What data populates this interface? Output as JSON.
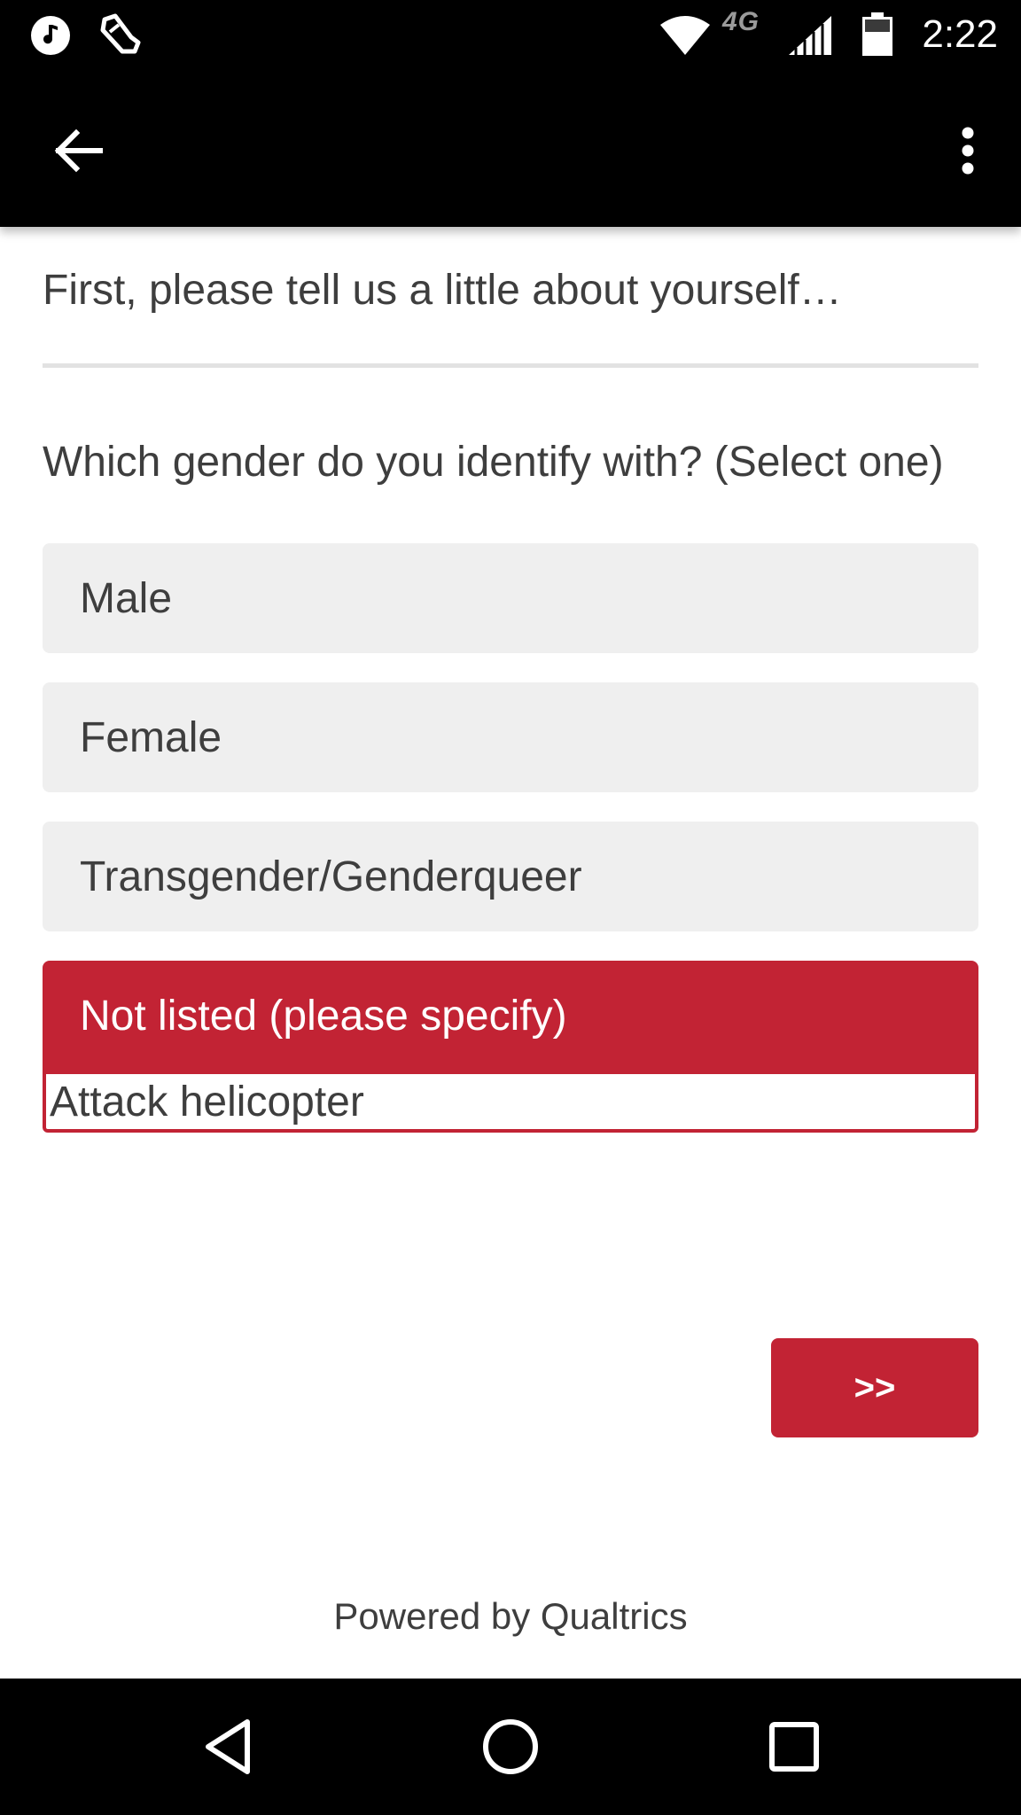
{
  "status_bar": {
    "time": "2:22",
    "network": "4G",
    "icons": [
      "music-icon",
      "fit-icon",
      "wifi-icon",
      "signal-icon",
      "battery-icon"
    ]
  },
  "app_bar": {
    "icons": [
      "back-arrow-icon",
      "overflow-menu-icon"
    ]
  },
  "survey": {
    "intro": "First, please tell us a little about yourself…",
    "question": "Which gender do you identify with? (Select one)",
    "choices": [
      {
        "label": "Male",
        "selected": false
      },
      {
        "label": "Female",
        "selected": false
      },
      {
        "label": "Transgender/Genderqueer",
        "selected": false
      },
      {
        "label": "Not listed (please specify)",
        "selected": true
      }
    ],
    "specify_value": "Attack helicopter",
    "next_label": ">>"
  },
  "footer": {
    "text": "Powered by Qualtrics"
  },
  "nav_bar": {
    "icons": [
      "back-triangle-icon",
      "home-circle-icon",
      "recents-square-icon"
    ]
  },
  "colors": {
    "accent": "#c22334",
    "choice_bg": "#efefef",
    "text": "#3e3e3e",
    "bars": "#000000"
  }
}
